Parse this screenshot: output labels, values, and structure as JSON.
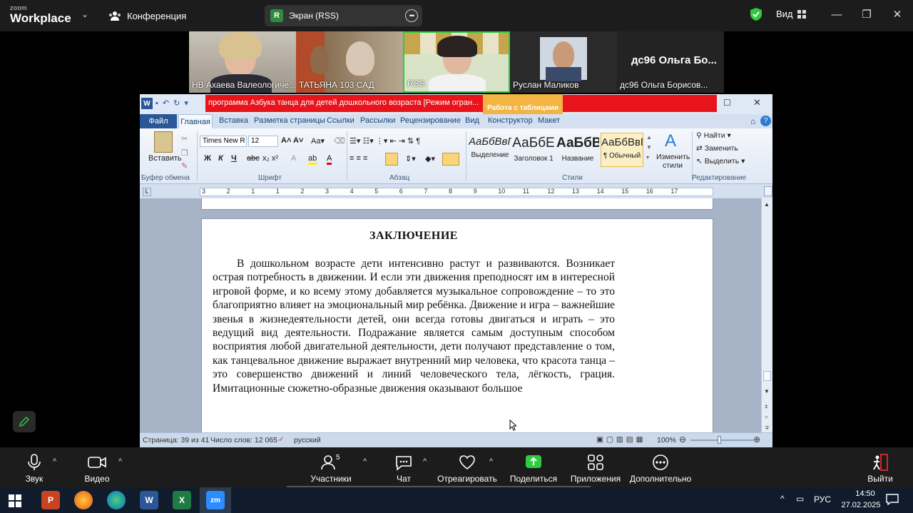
{
  "zoom": {
    "logo_small": "zoom",
    "logo_big": "Workplace",
    "conference_label": "Конференция",
    "screen_share_badge": "R",
    "screen_share_label": "Экран (RSS)",
    "view_label": "Вид"
  },
  "participants_tiles": [
    {
      "name": "НВ Ахаева Валеологиче..."
    },
    {
      "name": "ТАТЬЯНА 103 САД"
    },
    {
      "name": "RSS"
    },
    {
      "name": "Руслан Маликов"
    },
    {
      "name": "дс96 Ольга Борисов...",
      "big_name": "дс96 Ольга  Бо..."
    }
  ],
  "word": {
    "title": "программа Азбука танца для детей дошкольного возраста [Режим огран...",
    "context_tab_group": "Работа с таблицами",
    "tabs": [
      "Файл",
      "Главная",
      "Вставка",
      "Разметка страницы",
      "Ссылки",
      "Рассылки",
      "Рецензирование",
      "Вид",
      "Конструктор",
      "Макет"
    ],
    "ribbon": {
      "paste_label": "Вставить",
      "clipboard_group": "Буфер обмена",
      "font_name": "Times New R",
      "font_size": "12",
      "font_group": "Шрифт",
      "paragraph_group": "Абзац",
      "styles_group": "Стили",
      "editing_group": "Редактирование",
      "styles": [
        {
          "preview": "АаБбВвГ",
          "label": "Выделение"
        },
        {
          "preview": "АаБбЕ",
          "label": "Заголовок 1"
        },
        {
          "preview": "АаБбВ",
          "label": "Название"
        },
        {
          "preview": "АаБбВвГ",
          "label": "¶ Обычный"
        }
      ],
      "change_styles_label": "Изменить стили",
      "find_label": "Найти",
      "replace_label": "Заменить",
      "select_label": "Выделить"
    },
    "ruler_numbers": [
      "3",
      "2",
      "1",
      "1",
      "2",
      "3",
      "4",
      "5",
      "6",
      "7",
      "8",
      "9",
      "10",
      "11",
      "12",
      "13",
      "14",
      "15",
      "16",
      "17"
    ],
    "document": {
      "heading": "ЗАКЛЮЧЕНИЕ",
      "paragraph": "В дошкольном возрасте дети интенсивно растут и развиваются. Возникает острая потребность в движении. И если эти движения преподносят им в интересной игровой форме, и ко всему этому добавляется музыкальное сопровождение – то это благоприятно влияет на эмоциональный мир ребёнка. Движение и игра – важнейшие звенья в жизнедеятельности детей, они всегда готовы двигаться и играть – это ведущий вид деятельности. Подражание является самым доступным способом восприятия любой двигательной деятельности, дети получают представление о том, как танцевальное движение выражает внутренний мир человека, что красота танца – это совершенство движений и линий человеческого тела, лёгкость, грация. Имитационные сюжетно-образные движения оказывают большое"
    },
    "status": {
      "page": "Страница: 39 из 41",
      "words": "Число слов: 12 065",
      "language": "русский",
      "zoom": "100%"
    }
  },
  "toolbar": {
    "mute": "Звук",
    "video": "Видео",
    "participants": "Участники",
    "participants_count": "5",
    "chat": "Чат",
    "react": "Отреагировать",
    "share": "Поделиться",
    "apps": "Приложения",
    "more": "Дополнительно",
    "leave": "Выйти"
  },
  "taskbar": {
    "lang": "РУС",
    "time": "14:50",
    "date": "27.02.2025"
  },
  "colors": {
    "zoom_bg": "#1c1c1c",
    "share_green": "#2ecc40",
    "word_title_red": "#e8141b",
    "table_tools": "#f2b443"
  }
}
